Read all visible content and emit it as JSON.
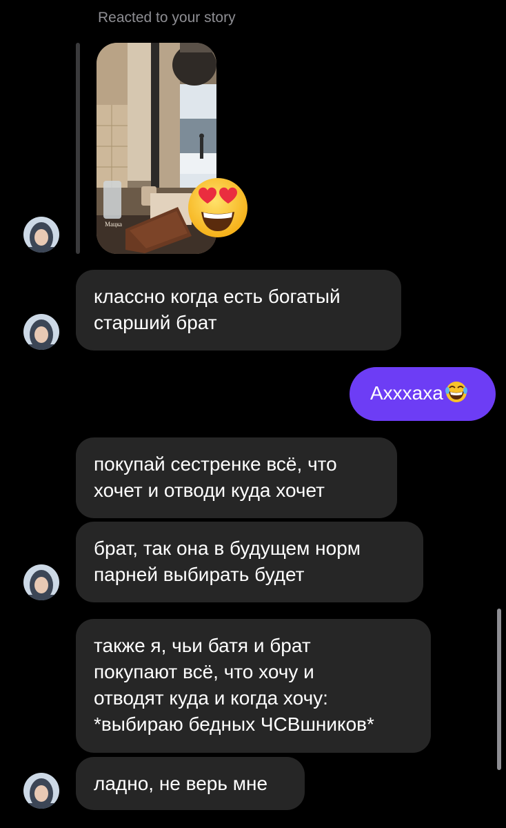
{
  "story": {
    "label": "Reacted to your story",
    "watermark": "Мацка",
    "reaction_icon": "heart-eyes-emoji"
  },
  "messages": [
    {
      "direction": "incoming",
      "text": "классно когда есть богатый\nстарший брат"
    },
    {
      "direction": "outgoing",
      "text": "Аxxxaxa",
      "emoji": "laughing-tears-emoji"
    },
    {
      "direction": "incoming",
      "text": "покупай сестренке всё, что\nхочет и отводи куда хочет"
    },
    {
      "direction": "incoming",
      "text": "брат, так она в будущем норм\nпарней выбирать будет"
    },
    {
      "direction": "incoming",
      "text": "также я, чьи батя и брат\nпокупают всё, что хочу и\nотводят куда и когда хочу:\n*выбираю бедных ЧСВшников*"
    },
    {
      "direction": "incoming",
      "text": "ладно, не верь мне"
    }
  ],
  "colors": {
    "background": "#000000",
    "incoming_bubble": "#262626",
    "outgoing_bubble": "#6d3df5",
    "meta_text": "#8e8e93"
  }
}
